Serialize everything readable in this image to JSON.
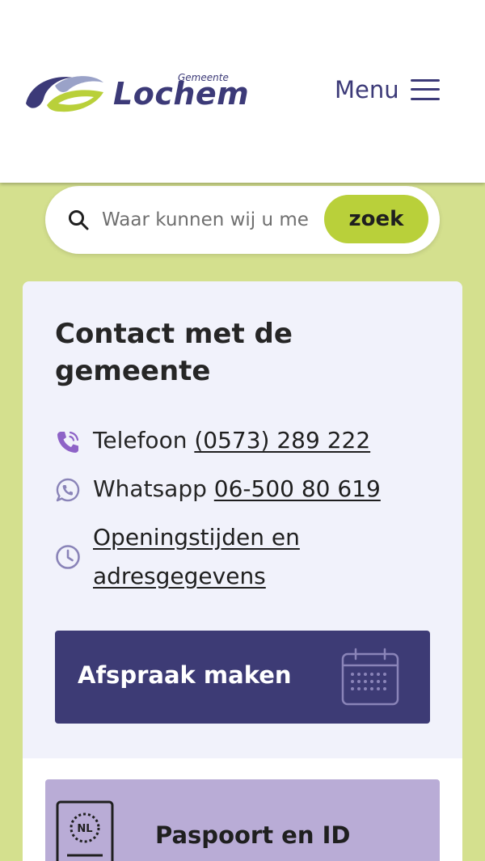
{
  "header": {
    "logo_small": "Gemeente",
    "logo_name": "Lochem",
    "menu_label": "Menu"
  },
  "search": {
    "placeholder": "Waar kunnen wij u mee helpen?",
    "button_label": "zoek"
  },
  "contact": {
    "title": "Contact met de gemeente",
    "phone": {
      "label": "Telefoon",
      "value": "(0573) 289 222"
    },
    "whatsapp": {
      "label": "Whatsapp",
      "value": "06-500 80 619"
    },
    "hours": {
      "line1": "Openingstijden en",
      "line2": "adresgegevens"
    },
    "appointment_label": "Afspraak maken"
  },
  "tiles": [
    {
      "label": "Paspoort en ID",
      "icon_text": "NL"
    }
  ],
  "colors": {
    "brand_purple": "#3d3b75",
    "brand_green": "#b9d03a",
    "page_background": "#d4e08e",
    "card_background": "#f1f2fb",
    "tile_purple": "#b9acd6"
  }
}
